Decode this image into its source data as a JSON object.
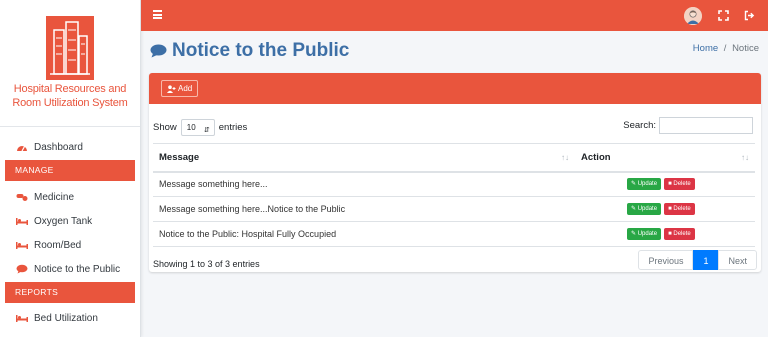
{
  "brand": {
    "name_line1": "Hospital Resources and",
    "name_line2": "Room Utilization System"
  },
  "sidebar": {
    "dashboard": "Dashboard",
    "manage_header": "MANAGE",
    "manage_items": [
      {
        "label": "Medicine",
        "icon": "pills-icon"
      },
      {
        "label": "Oxygen Tank",
        "icon": "bed-icon"
      },
      {
        "label": "Room/Bed",
        "icon": "bed-icon"
      },
      {
        "label": "Notice to the Public",
        "icon": "comment-icon"
      }
    ],
    "reports_header": "REPORTS",
    "reports_items": [
      {
        "label": "Bed Utilization",
        "icon": "bed-icon"
      }
    ]
  },
  "page": {
    "title": "Notice to the Public"
  },
  "breadcrumb": {
    "home": "Home",
    "sep": "/",
    "current": "Notice"
  },
  "card": {
    "add_label": "Add"
  },
  "table_controls": {
    "show_label": "Show",
    "length_value": "10",
    "entries_label": "entries",
    "search_label": "Search:",
    "search_value": ""
  },
  "table": {
    "columns": [
      "Message",
      "Action"
    ],
    "rows": [
      {
        "message": "Message something here..."
      },
      {
        "message": "Message something here...Notice to the Public"
      },
      {
        "message": "Notice to the Public: Hospital Fully Occupied"
      }
    ],
    "update_label": "Update",
    "delete_label": "Delete"
  },
  "footer": {
    "info": "Showing 1 to 3 of 3 entries",
    "previous": "Previous",
    "page": "1",
    "next": "Next"
  },
  "colors": {
    "accent": "#e9553d",
    "title": "#3d6fa6",
    "update": "#28a745",
    "delete": "#dc3545",
    "page_active": "#007bff"
  }
}
